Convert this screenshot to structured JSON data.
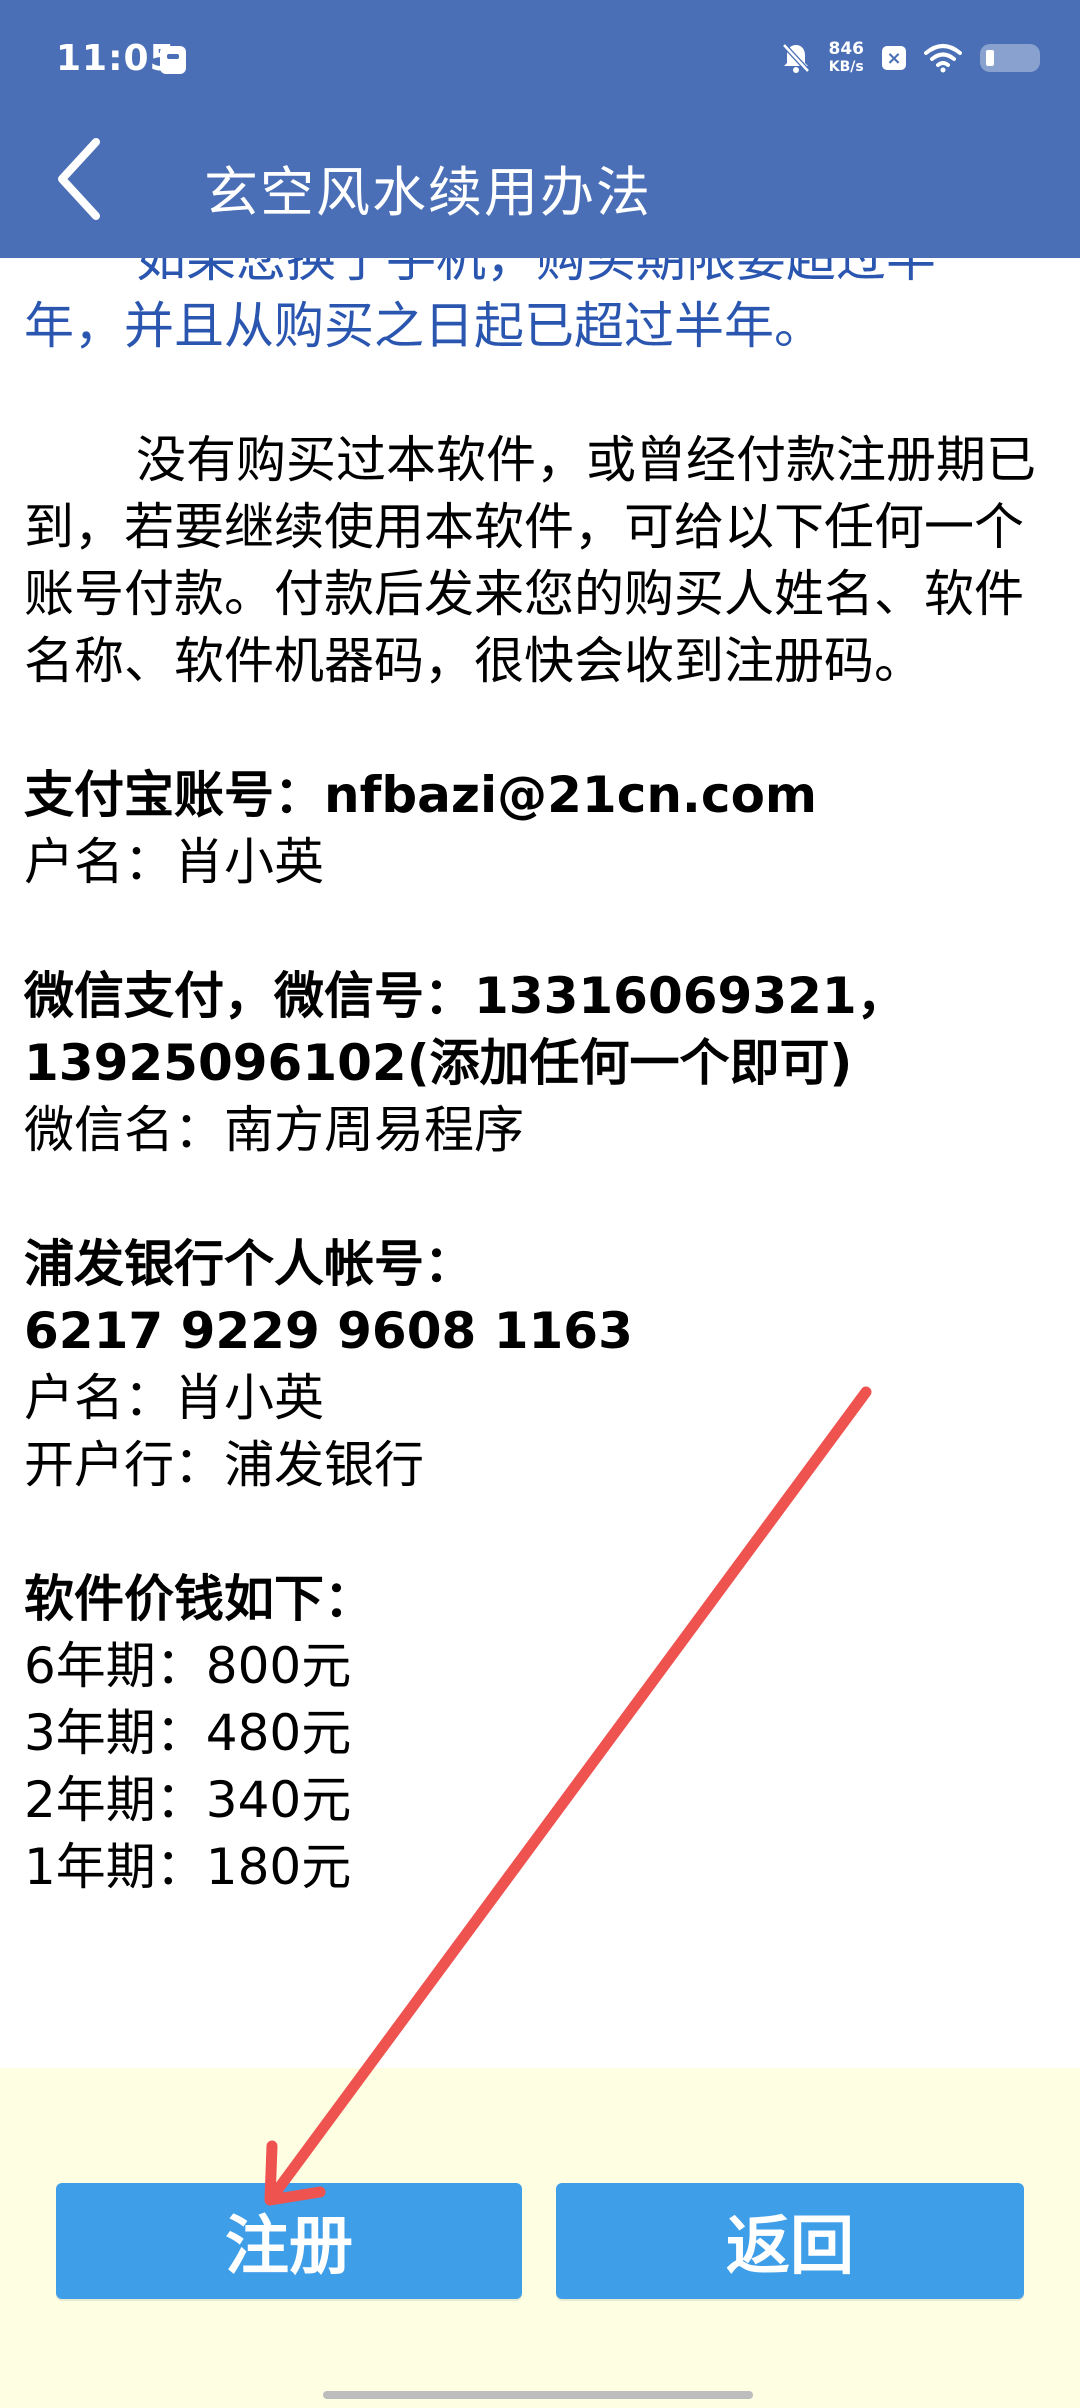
{
  "status_bar": {
    "time": "11:05",
    "net_speed_value": "846",
    "net_speed_unit": "KB/s"
  },
  "app_bar": {
    "title": "玄空风水续用办法"
  },
  "content": {
    "partial_line_1": "如果您换了手机，购买期限要超过半",
    "partial_line_2": "年，并且从购买之日起已超过半年。",
    "intro": "没有购买过本软件，或曾经付款注册期已到，若要继续使用本软件，可给以下任何一个账号付款。付款后发来您的购买人姓名、软件名称、软件机器码，很快会收到注册码。",
    "alipay_heading": "支付宝账号：nfbazi@21cn.com",
    "alipay_name": "户名：肖小英",
    "wechat_heading_1": "微信支付，微信号：13316069321，",
    "wechat_heading_2": "13925096102(添加任何一个即可)",
    "wechat_name": "微信名：南方周易程序",
    "bank_heading": "浦发银行个人帐号：",
    "bank_number": "6217 9229 9608 1163",
    "bank_holder": "户名：肖小英",
    "bank_branch": "开户行：浦发银行",
    "price_heading": "软件价钱如下：",
    "prices": [
      "6年期：800元",
      "3年期：480元",
      "2年期：340元",
      "1年期：180元"
    ]
  },
  "buttons": {
    "register_label": "注册",
    "back_label": "返回"
  },
  "colors": {
    "header": "#4b6fb6",
    "link_text": "#2a56b0",
    "button": "#3f9ee8",
    "bottom_bg": "#fefee2",
    "annotation": "#ef5350"
  },
  "icons": {
    "back": "chevron-left-icon",
    "mute": "bell-off-icon",
    "wifi": "wifi-icon",
    "battery": "battery-icon"
  }
}
